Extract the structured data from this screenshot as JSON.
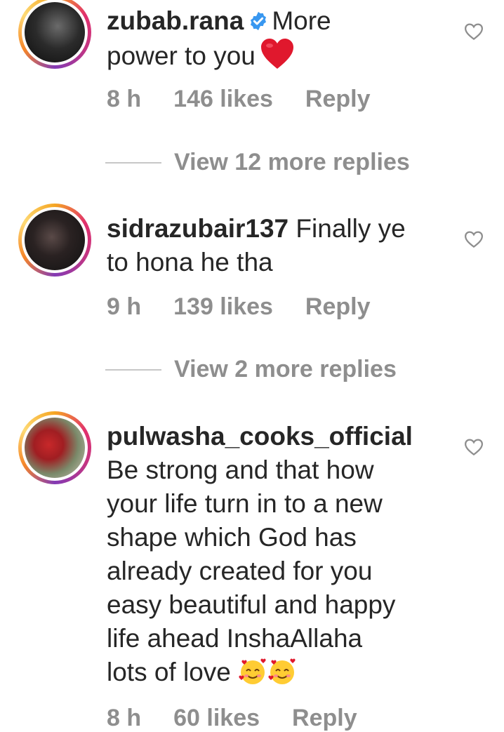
{
  "comments": [
    {
      "username": "zubab.rana",
      "verified": true,
      "text_line1_suffix": "More",
      "text_rest": "power to you",
      "emoji": "heart-emoji",
      "time": "8 h",
      "likes": "146 likes",
      "reply": "Reply",
      "view_replies": "View 12 more replies"
    },
    {
      "username": "sidrazubair137",
      "text_line1_suffix": "Finally ye",
      "text_rest": "to hona he tha",
      "time": "9 h",
      "likes": "139 likes",
      "reply": "Reply",
      "view_replies": "View 2 more replies"
    },
    {
      "username": "pulwasha_cooks_official",
      "text_lines": [
        "Be strong and that how",
        "your life turn in to a new",
        "shape which God has",
        "already created for you",
        "easy beautiful and happy",
        "life ahead InshaAllaha",
        "lots of love"
      ],
      "emoji": "smiling-face-with-hearts-emoji",
      "time": "8 h",
      "likes": "60 likes",
      "reply": "Reply"
    }
  ],
  "icons": {
    "like": "heart-outline-icon",
    "verified": "verified-badge-icon"
  },
  "colors": {
    "text": "#262626",
    "secondary": "#8e8e8e",
    "verified": "#3897f0",
    "heart_emoji": "#e0182d"
  }
}
